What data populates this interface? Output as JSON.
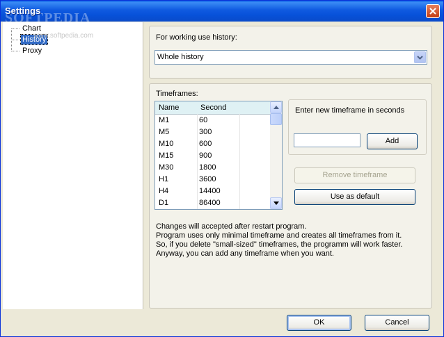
{
  "window": {
    "title": "Settings",
    "watermark": "SOFTPEDIA",
    "watermark_url": "www.softpedia.com"
  },
  "tree": {
    "items": [
      {
        "label": "Chart",
        "selected": false
      },
      {
        "label": "History",
        "selected": true
      },
      {
        "label": "Proxy",
        "selected": false
      }
    ]
  },
  "history": {
    "use_label": "For working use history:",
    "use_value": "Whole history",
    "timeframes_label": "Timeframes:",
    "columns": [
      "Name",
      "Second"
    ],
    "rows": [
      [
        "M1",
        "60"
      ],
      [
        "M5",
        "300"
      ],
      [
        "M10",
        "600"
      ],
      [
        "M15",
        "900"
      ],
      [
        "M30",
        "1800"
      ],
      [
        "H1",
        "3600"
      ],
      [
        "H4",
        "14400"
      ],
      [
        "D1",
        "86400"
      ]
    ],
    "enter_label": "Enter new timeframe in seconds",
    "new_value": "",
    "add_label": "Add",
    "remove_label": "Remove timeframe",
    "default_label": "Use as default",
    "info": [
      "Changes will accepted after restart program.",
      "Program uses only minimal timeframe and creates all timeframes from it.",
      "So, if you delete \"small-sized\" timeframes, the programm will work faster.",
      "Anyway, you can add any timeframe when you want."
    ]
  },
  "footer": {
    "ok_label": "OK",
    "cancel_label": "Cancel"
  },
  "colors": {
    "titlebar": "#0751d9",
    "selection": "#316ac5",
    "list_header": "#dff1f4"
  }
}
